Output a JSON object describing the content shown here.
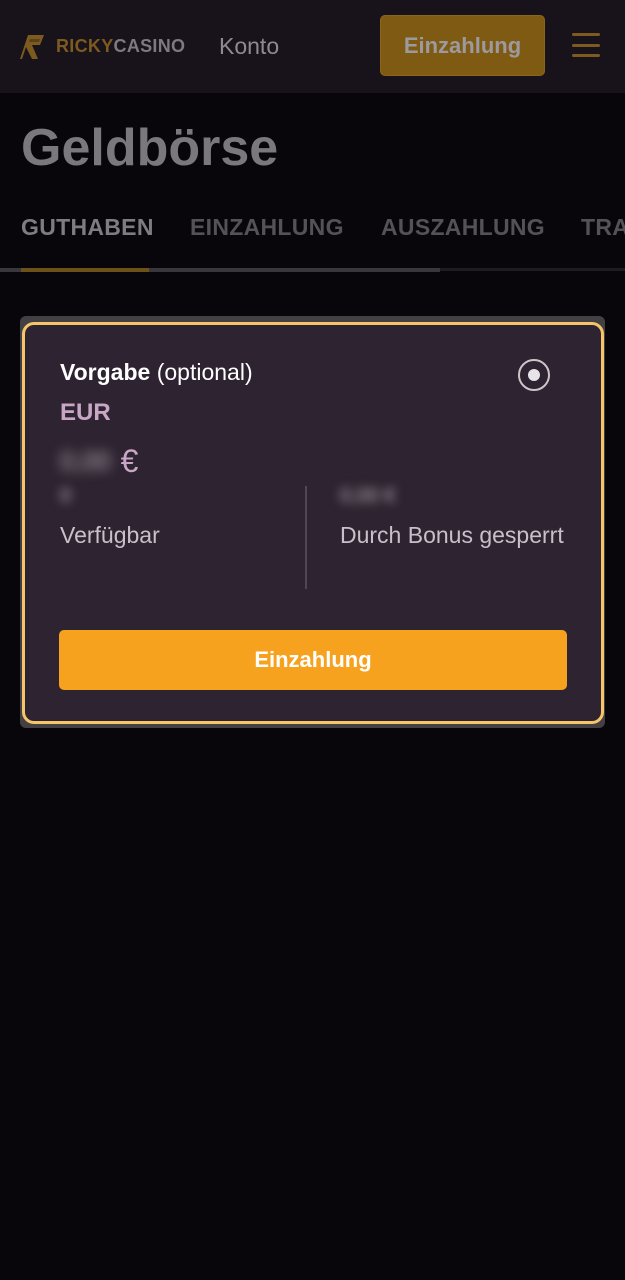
{
  "header": {
    "logo": {
      "part1": "RICKY",
      "part2": "CASINO"
    },
    "account_label": "Konto",
    "deposit_button": "Einzahlung"
  },
  "page": {
    "title": "Geldbörse"
  },
  "tabs": [
    {
      "label": "GUTHABEN",
      "active": true
    },
    {
      "label": "EINZAHLUNG",
      "active": false
    },
    {
      "label": "AUSZAHLUNG",
      "active": false
    },
    {
      "label": "TRA",
      "active": false
    }
  ],
  "wallet_card": {
    "title_bold": "Vorgabe",
    "title_rest": " (optional)",
    "currency": "EUR",
    "balance_hidden": "0,00",
    "currency_symbol": "€",
    "available_value_hidden": "0",
    "available_label": "Verfügbar",
    "bonus_value_hidden": "0,00 €",
    "bonus_label": "Durch Bonus gesperrt",
    "deposit_button": "Einzahlung"
  },
  "colors": {
    "accent": "#f7a21e",
    "card_border": "#f6c56a",
    "card_bg": "#2e2330",
    "page_bg": "#09060b"
  }
}
